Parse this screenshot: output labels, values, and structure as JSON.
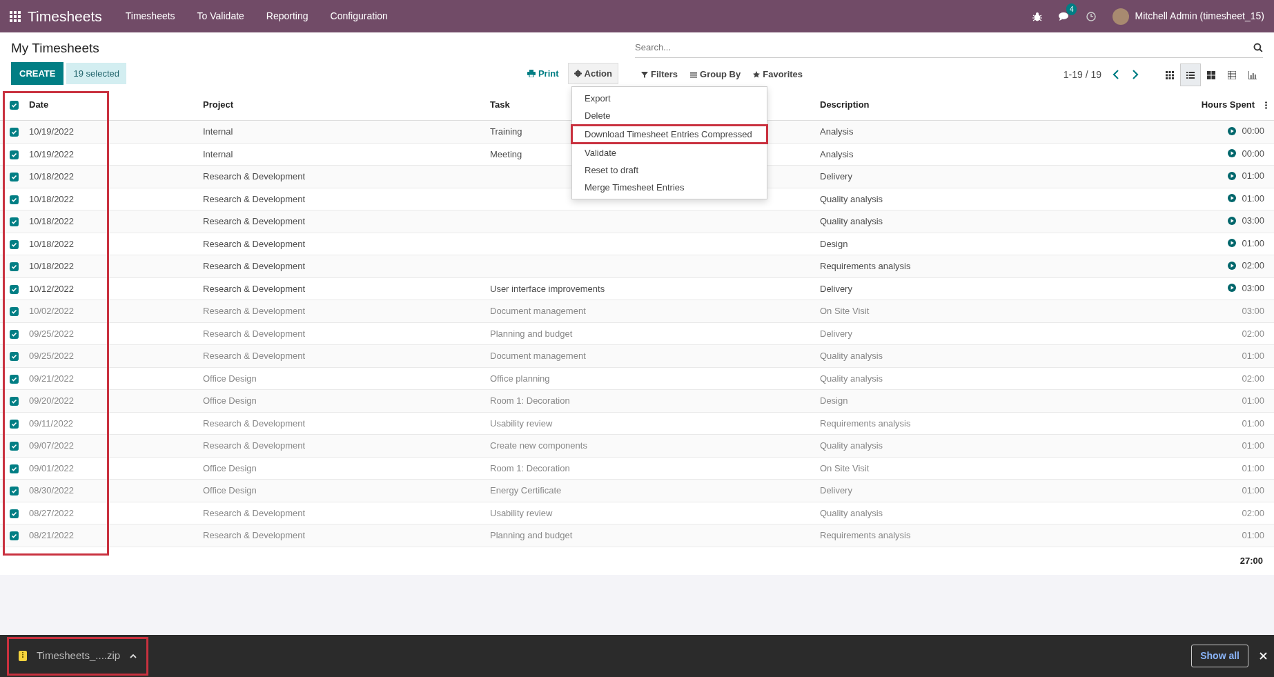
{
  "navbar": {
    "app_title": "Timesheets",
    "menu": [
      "Timesheets",
      "To Validate",
      "Reporting",
      "Configuration"
    ],
    "messages_count": "4",
    "user": "Mitchell Admin (timesheet_15)"
  },
  "page_title": "My Timesheets",
  "search": {
    "placeholder": "Search..."
  },
  "buttons": {
    "create": "CREATE",
    "selected": "19 selected",
    "print": "Print",
    "action": "Action"
  },
  "action_menu": {
    "expanded": true,
    "items": [
      {
        "label": "Export",
        "highlighted": false
      },
      {
        "label": "Delete",
        "highlighted": false
      },
      {
        "label": "Download Timesheet Entries Compressed",
        "highlighted": true
      },
      {
        "label": "Validate",
        "highlighted": false
      },
      {
        "label": "Reset to draft",
        "highlighted": false
      },
      {
        "label": "Merge Timesheet Entries",
        "highlighted": false
      }
    ]
  },
  "filters": [
    "Filters",
    "Group By",
    "Favorites"
  ],
  "pager": "1-19 / 19",
  "views": [
    {
      "kind": "kanban",
      "selected": false
    },
    {
      "kind": "list",
      "selected": true
    },
    {
      "kind": "grid",
      "selected": false
    },
    {
      "kind": "pivot",
      "selected": false
    },
    {
      "kind": "graph",
      "selected": false
    }
  ],
  "table": {
    "select_all_checked": true,
    "date_column_highlighted": true,
    "columns": [
      "Date",
      "Project",
      "Task",
      "Description",
      "Hours Spent"
    ],
    "rows": [
      {
        "checked": true,
        "validated": false,
        "date": "10/19/2022",
        "project": "Internal",
        "task": "Training",
        "description": "Analysis",
        "hours": "00:00"
      },
      {
        "checked": true,
        "validated": false,
        "date": "10/19/2022",
        "project": "Internal",
        "task": "Meeting",
        "description": "Analysis",
        "hours": "00:00"
      },
      {
        "checked": true,
        "validated": false,
        "date": "10/18/2022",
        "project": "Research & Development",
        "task": "",
        "description": "Delivery",
        "hours": "01:00"
      },
      {
        "checked": true,
        "validated": false,
        "date": "10/18/2022",
        "project": "Research & Development",
        "task": "",
        "description": "Quality analysis",
        "hours": "01:00"
      },
      {
        "checked": true,
        "validated": false,
        "date": "10/18/2022",
        "project": "Research & Development",
        "task": "",
        "description": "Quality analysis",
        "hours": "03:00"
      },
      {
        "checked": true,
        "validated": false,
        "date": "10/18/2022",
        "project": "Research & Development",
        "task": "",
        "description": "Design",
        "hours": "01:00"
      },
      {
        "checked": true,
        "validated": false,
        "date": "10/18/2022",
        "project": "Research & Development",
        "task": "",
        "description": "Requirements analysis",
        "hours": "02:00"
      },
      {
        "checked": true,
        "validated": false,
        "date": "10/12/2022",
        "project": "Research & Development",
        "task": "User interface improvements",
        "description": "Delivery",
        "hours": "03:00"
      },
      {
        "checked": true,
        "validated": true,
        "date": "10/02/2022",
        "project": "Research & Development",
        "task": "Document management",
        "description": "On Site Visit",
        "hours": "03:00"
      },
      {
        "checked": true,
        "validated": true,
        "date": "09/25/2022",
        "project": "Research & Development",
        "task": "Planning and budget",
        "description": "Delivery",
        "hours": "02:00"
      },
      {
        "checked": true,
        "validated": true,
        "date": "09/25/2022",
        "project": "Research & Development",
        "task": "Document management",
        "description": "Quality analysis",
        "hours": "01:00"
      },
      {
        "checked": true,
        "validated": true,
        "date": "09/21/2022",
        "project": "Office Design",
        "task": "Office planning",
        "description": "Quality analysis",
        "hours": "02:00"
      },
      {
        "checked": true,
        "validated": true,
        "date": "09/20/2022",
        "project": "Office Design",
        "task": "Room 1: Decoration",
        "description": "Design",
        "hours": "01:00"
      },
      {
        "checked": true,
        "validated": true,
        "date": "09/11/2022",
        "project": "Research & Development",
        "task": "Usability review",
        "description": "Requirements analysis",
        "hours": "01:00"
      },
      {
        "checked": true,
        "validated": true,
        "date": "09/07/2022",
        "project": "Research & Development",
        "task": "Create new components",
        "description": "Quality analysis",
        "hours": "01:00"
      },
      {
        "checked": true,
        "validated": true,
        "date": "09/01/2022",
        "project": "Office Design",
        "task": "Room 1: Decoration",
        "description": "On Site Visit",
        "hours": "01:00"
      },
      {
        "checked": true,
        "validated": true,
        "date": "08/30/2022",
        "project": "Office Design",
        "task": "Energy Certificate",
        "description": "Delivery",
        "hours": "01:00"
      },
      {
        "checked": true,
        "validated": true,
        "date": "08/27/2022",
        "project": "Research & Development",
        "task": "Usability review",
        "description": "Quality analysis",
        "hours": "02:00"
      },
      {
        "checked": true,
        "validated": true,
        "date": "08/21/2022",
        "project": "Research & Development",
        "task": "Planning and budget",
        "description": "Requirements analysis",
        "hours": "01:00"
      }
    ],
    "total": "27:00"
  },
  "download_bar": {
    "file": "Timesheets_....zip",
    "highlighted": true,
    "show_all": "Show all"
  }
}
